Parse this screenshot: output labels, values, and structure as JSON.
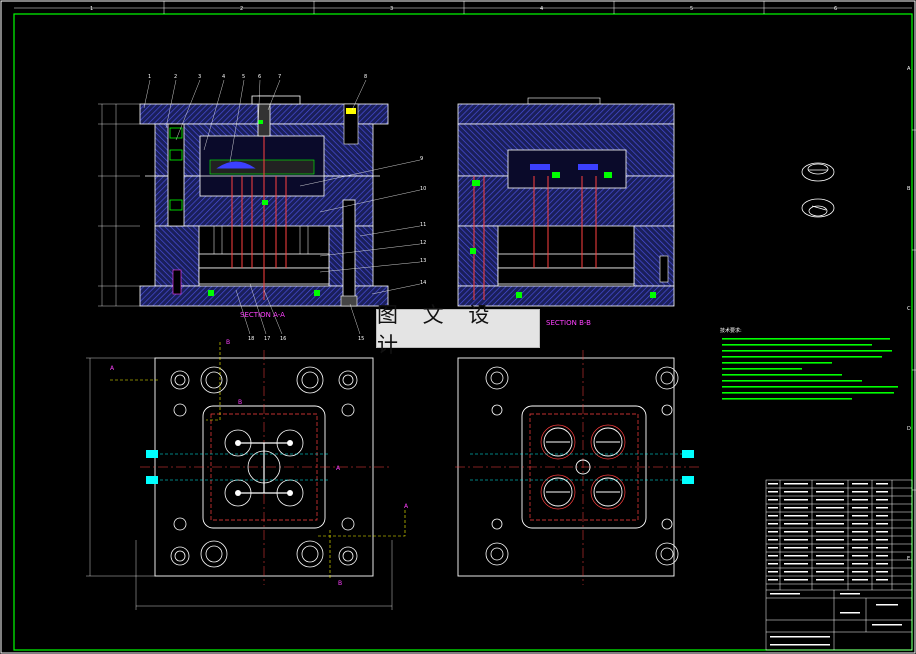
{
  "drawing": {
    "section_labels": {
      "aa": "SECTION A-A",
      "bb": "SECTION B-B"
    },
    "part_numbers_top": [
      "1",
      "2",
      "3",
      "4",
      "5",
      "6",
      "7",
      "8"
    ],
    "part_numbers_right": [
      "9",
      "10",
      "11",
      "12",
      "13",
      "14"
    ],
    "part_numbers_bottom": [
      "15",
      "16",
      "17",
      "18"
    ],
    "border_top_marks": [
      "1",
      "2",
      "3",
      "4",
      "5",
      "6"
    ],
    "border_side_marks": [
      "A",
      "B",
      "C",
      "D",
      "E"
    ],
    "cut_marks": [
      "A",
      "B"
    ],
    "notes_title": "技术要求:",
    "watermark": "图 文 设 计"
  },
  "colors": {
    "background": "#000000",
    "outline": "#ffffff",
    "hatch": "#3b40c8",
    "pins": "#ff4040",
    "green": "#00ff00",
    "yellow": "#ffff00",
    "cyan": "#00ffff",
    "magenta": "#ff40ff"
  }
}
